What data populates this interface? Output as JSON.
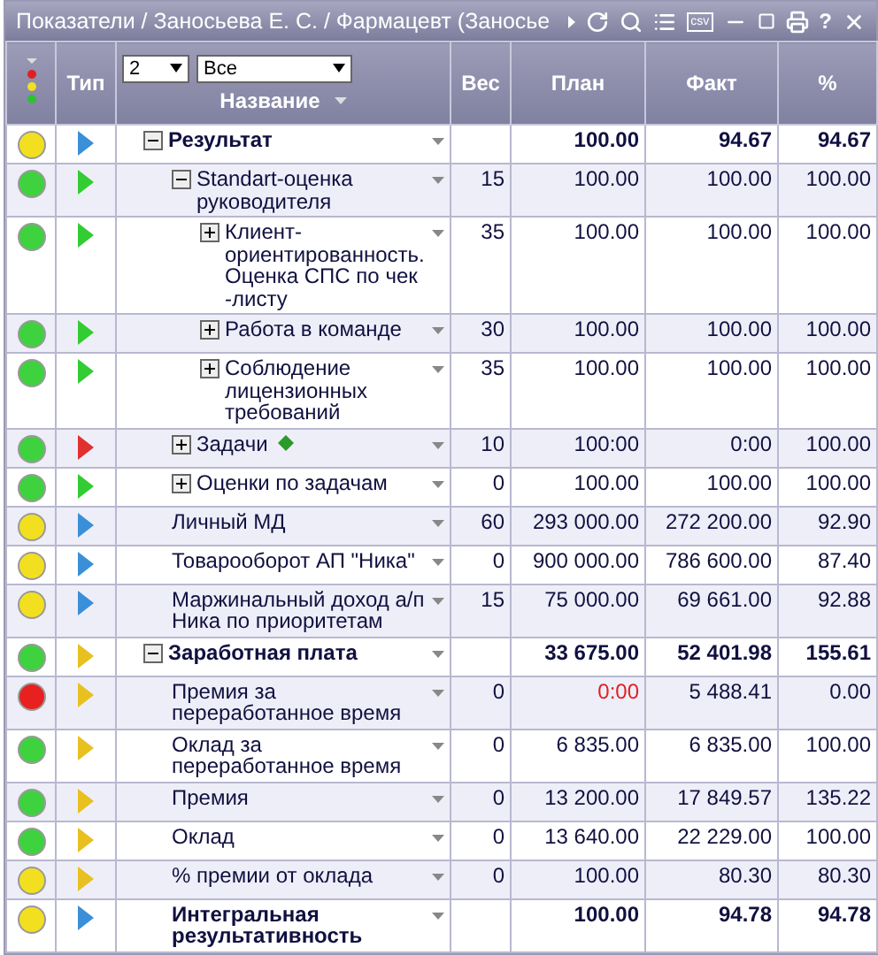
{
  "window": {
    "title": "Показатели / Заносьева Е. С. / Фармацевт (Заносье",
    "csv_label": "csv",
    "help_label": "?"
  },
  "table": {
    "columns": {
      "type": "Тип",
      "name": "Название",
      "weight": "Вес",
      "plan": "План",
      "fact": "Факт",
      "pct": "%"
    },
    "level_filter": "2",
    "scope_filter": "Все",
    "rows": [
      {
        "name": "Результат",
        "color": "#f2e020",
        "kind": "standard",
        "expanded": true,
        "total": true,
        "plan_alert": false,
        "weight": "",
        "plan": "100.00",
        "fact": "94.67",
        "pct": "94.67",
        "children": [
          {
            "name": "Standart-оценка руководителя",
            "color": "#3fd23f",
            "kind": "success",
            "expanded": true,
            "total": false,
            "plan_alert": false,
            "weight": "15",
            "plan": "100.00",
            "fact": "100.00",
            "pct": "100.00",
            "children": [
              {
                "name": "Клиент-ориентированность. Оценка СПС по чек -листу",
                "color": "#3fd23f",
                "kind": "success",
                "expanded": false,
                "total": false,
                "plan_alert": false,
                "weight": "35",
                "plan": "100.00",
                "fact": "100.00",
                "pct": "100.00"
              },
              {
                "name": "Работа в команде",
                "color": "#3fd23f",
                "kind": "success",
                "expanded": false,
                "total": false,
                "plan_alert": false,
                "weight": "30",
                "plan": "100.00",
                "fact": "100.00",
                "pct": "100.00"
              },
              {
                "name": "Соблюдение лицензионных требований",
                "color": "#3fd23f",
                "kind": "success",
                "expanded": false,
                "total": false,
                "plan_alert": false,
                "weight": "35",
                "plan": "100.00",
                "fact": "100.00",
                "pct": "100.00"
              }
            ]
          },
          {
            "name": "Задачи",
            "color": "#3fd23f",
            "kind": "failed",
            "expanded": false,
            "task_marker": true,
            "total": false,
            "plan_alert": false,
            "weight": "10",
            "plan": "100:00",
            "fact": "0:00",
            "pct": "100.00"
          },
          {
            "name": "Оценки по задачам",
            "color": "#3fd23f",
            "kind": "success",
            "expanded": false,
            "total": false,
            "plan_alert": false,
            "weight": "0",
            "plan": "100.00",
            "fact": "100.00",
            "pct": "100.00"
          },
          {
            "name": "Личный МД",
            "color": "#f2e020",
            "kind": "standard",
            "total": false,
            "plan_alert": false,
            "weight": "60",
            "plan": "293 000.00",
            "fact": "272 200.00",
            "pct": "92.90"
          },
          {
            "name": "Товарооборот АП \"Ника\"",
            "color": "#f2e020",
            "kind": "standard",
            "total": false,
            "plan_alert": false,
            "weight": "0",
            "plan": "900 000.00",
            "fact": "786 600.00",
            "pct": "87.40"
          },
          {
            "name": "Маржинальный доход а/п Ника по приоритетам",
            "color": "#f2e020",
            "kind": "standard",
            "total": false,
            "plan_alert": false,
            "weight": "15",
            "plan": "75 000.00",
            "fact": "69 661.00",
            "pct": "92.88"
          }
        ]
      },
      {
        "name": "Заработная плата",
        "color": "#3fd23f",
        "kind": "salary",
        "expanded": true,
        "total": true,
        "plan_alert": false,
        "weight": "",
        "plan": "33 675.00",
        "fact": "52 401.98",
        "pct": "155.61",
        "children": [
          {
            "name": "Премия за переработанное время",
            "color": "#e82020",
            "kind": "salary",
            "total": false,
            "plan_alert": true,
            "weight": "0",
            "plan": "0:00",
            "fact": "5 488.41",
            "pct": "0.00"
          },
          {
            "name": "Оклад за переработанное время",
            "color": "#3fd23f",
            "kind": "salary",
            "total": false,
            "plan_alert": false,
            "weight": "0",
            "plan": "6 835.00",
            "fact": "6 835.00",
            "pct": "100.00"
          },
          {
            "name": "Премия",
            "color": "#3fd23f",
            "kind": "salary",
            "total": false,
            "plan_alert": false,
            "weight": "0",
            "plan": "13 200.00",
            "fact": "17 849.57",
            "pct": "135.22"
          },
          {
            "name": "Оклад",
            "color": "#3fd23f",
            "kind": "salary",
            "total": false,
            "plan_alert": false,
            "weight": "0",
            "plan": "13 640.00",
            "fact": "22 229.00",
            "pct": "100.00"
          },
          {
            "name": "% премии от оклада",
            "color": "#f2e020",
            "kind": "salary",
            "total": false,
            "plan_alert": false,
            "weight": "0",
            "plan": "100.00",
            "fact": "80.30",
            "pct": "80.30"
          }
        ]
      },
      {
        "name": "Интегральная результативность",
        "color": "#f2e020",
        "kind": "standard",
        "total": true,
        "plan_alert": false,
        "weight": "",
        "plan": "100.00",
        "fact": "94.78",
        "pct": "94.78"
      }
    ]
  }
}
